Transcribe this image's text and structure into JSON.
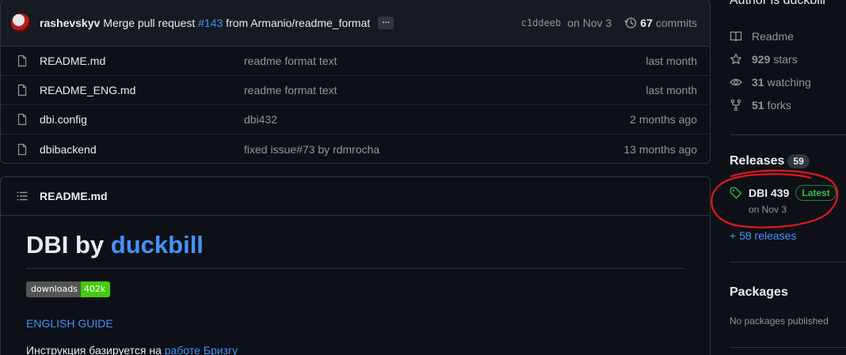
{
  "commit": {
    "author": "rashevskyv",
    "message_prefix": "Merge pull request ",
    "pr_link": "#143",
    "message_suffix": " from Armanio/readme_format",
    "ellipsis": "…",
    "sha": "c1ddeeb",
    "date": "on Nov 3",
    "commits_count": "67",
    "commits_label": "commits"
  },
  "files": [
    {
      "name": "README.md",
      "message": "readme format text",
      "age": "last month"
    },
    {
      "name": "README_ENG.md",
      "message": "readme format text",
      "age": "last month"
    },
    {
      "name": "dbi.config",
      "message": "dbi432",
      "age": "2 months ago"
    },
    {
      "name": "dbibackend",
      "message": "fixed issue#73 by rdmrocha",
      "age": "13 months ago"
    }
  ],
  "readme": {
    "filename": "README.md",
    "title_prefix": "DBI by ",
    "title_link": "duckbill",
    "badge_label": "downloads",
    "badge_value": "402k",
    "guide_link": "ENGLISH GUIDE",
    "para_prefix": "Инструкция базируется на ",
    "para_link": "работе Бризгу"
  },
  "sidebar": {
    "author_note": "Author is duckbill",
    "readme_label": "Readme",
    "stars_count": "929",
    "stars_label": "stars",
    "watching_count": "31",
    "watching_label": "watching",
    "forks_count": "51",
    "forks_label": "forks",
    "releases_title": "Releases",
    "releases_count": "59",
    "release_name": "DBI 439",
    "latest_label": "Latest",
    "release_date": "on Nov 3",
    "more_releases": "+ 58 releases",
    "packages_title": "Packages",
    "no_packages": "No packages published"
  },
  "colors": {
    "background": "#0d1117",
    "link": "#4493f8",
    "latest_badge": "#3fb950",
    "annotation_circle": "#e3171b"
  }
}
